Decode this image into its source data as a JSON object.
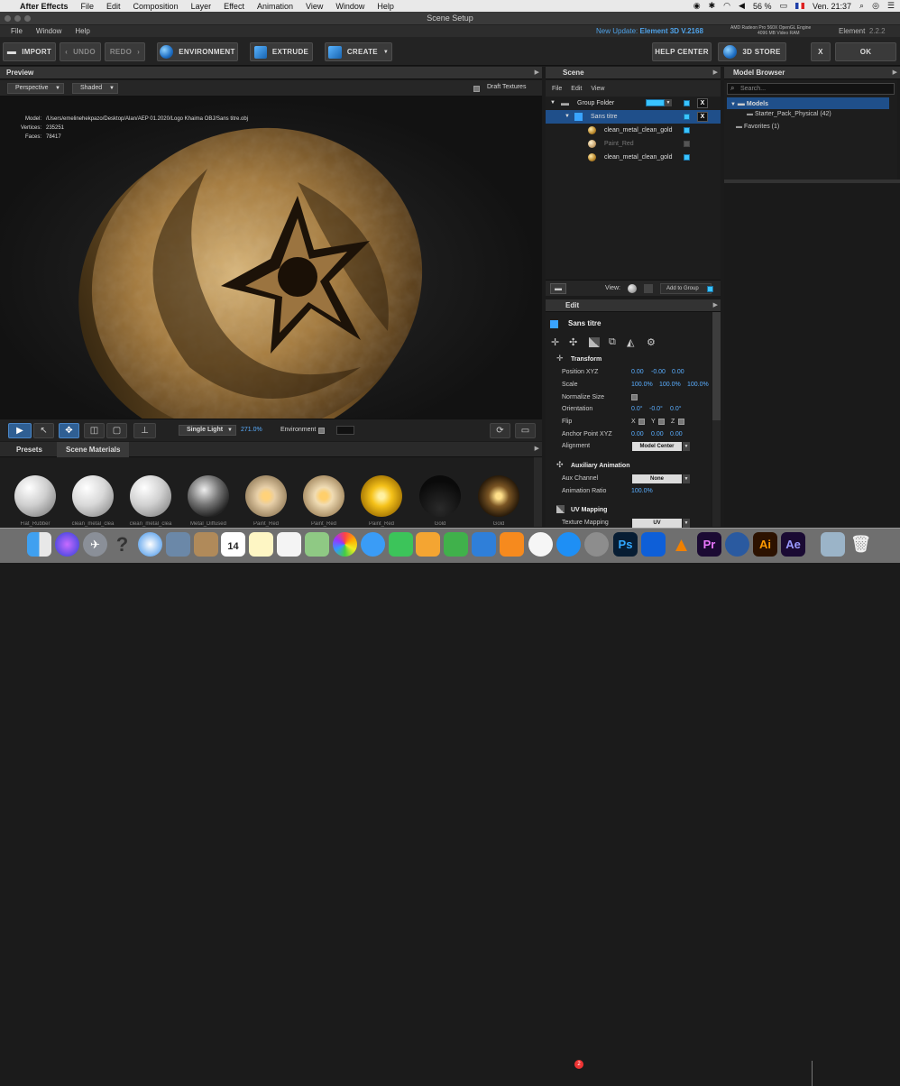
{
  "menubar": {
    "app": "After Effects",
    "items": [
      "File",
      "Edit",
      "Composition",
      "Layer",
      "Effect",
      "Animation",
      "View",
      "Window",
      "Help"
    ],
    "battery": "56 %",
    "clock": "Ven. 21:37"
  },
  "window": {
    "title": "Scene Setup"
  },
  "appmenu": {
    "items": [
      "File",
      "Window",
      "Help"
    ],
    "update_label": "New Update:",
    "update_value": "Element 3D V.2168",
    "gpu_line1": "AMD Radeon Pro 560X OpenGL Engine",
    "gpu_line2": "4096 MB Video RAM",
    "element_label": "Element",
    "element_version": "2.2.2"
  },
  "toolbar": {
    "import": "IMPORT",
    "undo": "UNDO",
    "redo": "REDO",
    "environment": "ENVIRONMENT",
    "extrude": "EXTRUDE",
    "create": "CREATE",
    "help_center": "HELP CENTER",
    "store": "3D STORE",
    "close": "X",
    "ok": "OK"
  },
  "preview": {
    "title": "Preview",
    "view_mode": "Perspective",
    "shade_mode": "Shaded",
    "draft_textures": "Draft Textures",
    "info": {
      "model_k": "Model:",
      "model_v": "/Users/emelinehekpazo/Desktop/Alan/AEP 01.2020/Logo Khaima OBJ/Sans titre.obj",
      "vertices_k": "Vertices:",
      "vertices_v": "235251",
      "faces_k": "Faces:",
      "faces_v": "78417"
    },
    "light": "Single Light",
    "light_value": "271.0%",
    "environment": "Environment"
  },
  "presets": {
    "tabs": [
      "Presets",
      "Scene Materials"
    ],
    "materials": [
      "Flat_Rubber",
      "clean_metal_clea",
      "clean_metal_clea",
      "Metal_Diffused",
      "Paint_Red",
      "Paint_Red",
      "Paint_Red",
      "Gold",
      "Gold"
    ]
  },
  "scene": {
    "title": "Scene",
    "menu": [
      "File",
      "Edit",
      "View"
    ],
    "rows": [
      {
        "label": "Group Folder"
      },
      {
        "label": "Sans titre"
      },
      {
        "label": "clean_metal_clean_gold"
      },
      {
        "label": "Paint_Red"
      },
      {
        "label": "clean_metal_clean_gold"
      }
    ],
    "view_label": "View:",
    "add_group": "Add to Group"
  },
  "edit": {
    "title": "Edit",
    "object": "Sans titre",
    "transform": "Transform",
    "position_k": "Position XYZ",
    "position_v": [
      "0.00",
      "-0.00",
      "0.00"
    ],
    "scale_k": "Scale",
    "scale_v": [
      "100.0%",
      "100.0%",
      "100.0%"
    ],
    "normalize_k": "Normalize Size",
    "orientation_k": "Orientation",
    "orientation_v": [
      "0.0°",
      "-0.0°",
      "0.0°"
    ],
    "flip_k": "Flip",
    "flip_x": "X",
    "flip_y": "Y",
    "flip_z": "Z",
    "anchor_k": "Anchor Point XYZ",
    "anchor_v": [
      "0.00",
      "0.00",
      "0.00"
    ],
    "align_k": "Alignment",
    "align_v": "Model Center",
    "aux": "Auxiliary Animation",
    "aux_channel_k": "Aux Channel",
    "aux_channel_v": "None",
    "anim_ratio_k": "Animation Ratio",
    "anim_ratio_v": "100.0%",
    "uv": "UV Mapping",
    "tex_k": "Texture Mapping",
    "tex_v": "UV"
  },
  "model_browser": {
    "title": "Model Browser",
    "search_placeholder": "Search...",
    "models": "Models",
    "starter": "Starter_Pack_Physical (42)",
    "favorites": "Favorites (1)"
  },
  "dock": {
    "icons": [
      "finder-icon",
      "siri-icon",
      "launchpad-icon",
      "help-icon",
      "safari-icon",
      "preview-icon",
      "contacts-icon",
      "calendar-icon",
      "notes-icon",
      "reminders-icon",
      "maps-icon",
      "photos-icon",
      "messages-icon",
      "facetime-icon",
      "pages-icon",
      "numbers-icon",
      "keynote-icon",
      "books-icon",
      "music-icon",
      "appstore-icon",
      "settings-icon",
      "photoshop-icon",
      "teamviewer-icon",
      "vlc-icon",
      "premiere-icon",
      "blender-icon",
      "illustrator-icon",
      "aftereffects-icon",
      "screenshot-icon",
      "trash-icon"
    ],
    "calendar_day": "14",
    "appstore_badge": "2",
    "ps": "Ps",
    "pr": "Pr",
    "ai": "Ai",
    "ae": "Ae"
  }
}
